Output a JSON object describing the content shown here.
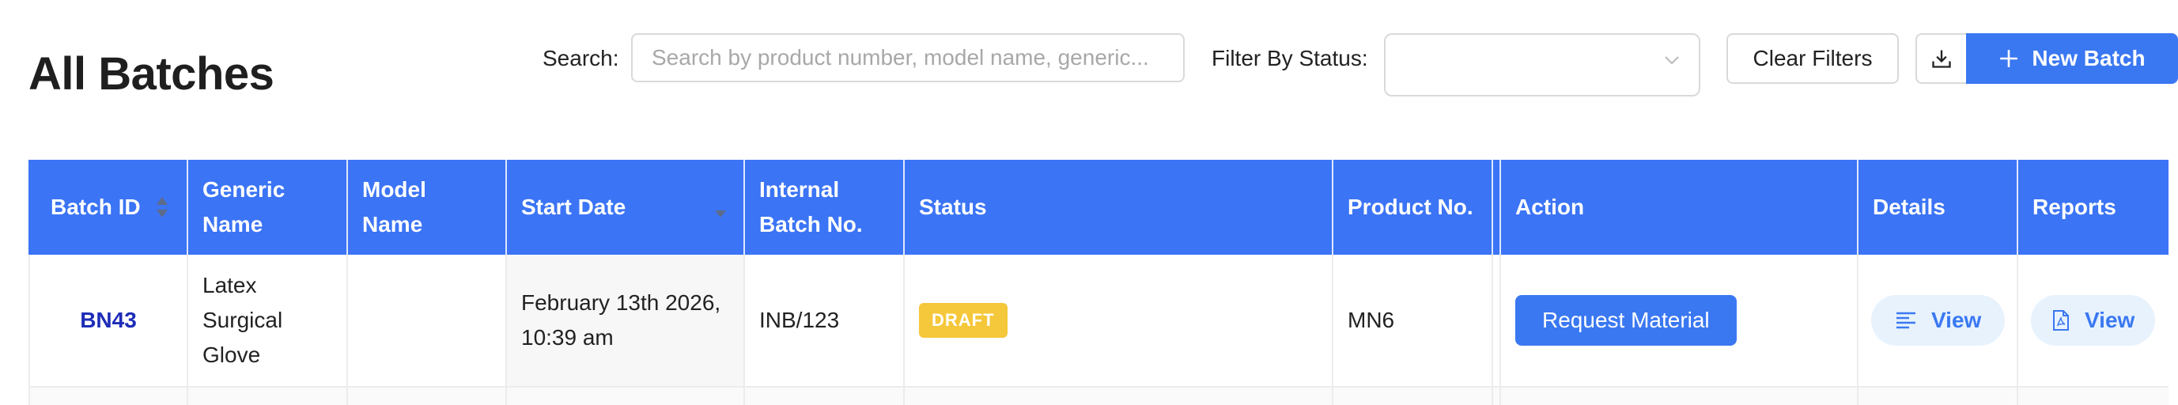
{
  "page": {
    "title": "All Batches"
  },
  "toolbar": {
    "search_label": "Search:",
    "search_placeholder": "Search by product number, model name, generic...",
    "search_value": "",
    "filter_label": "Filter By Status:",
    "filter_value": "",
    "clear_label": "Clear Filters",
    "new_batch_label": "New Batch"
  },
  "table": {
    "headers": {
      "batch_id": "Batch ID",
      "generic_name": [
        "Generic",
        "Name"
      ],
      "model_name": [
        "Model",
        "Name"
      ],
      "start_date": "Start Date",
      "internal_batch": [
        "Internal",
        "Batch No."
      ],
      "status": "Status",
      "product_no": "Product No.",
      "action": "Action",
      "details": "Details",
      "reports": "Reports"
    },
    "rows": [
      {
        "batch_id": "BN43",
        "generic_name": [
          "Latex",
          "Surgical",
          "Glove"
        ],
        "model_name": "",
        "start_date": [
          "February 13th 2026,",
          "10:39 am"
        ],
        "internal_batch": "INB/123",
        "status": "DRAFT",
        "product_no": "MN6",
        "action": "Request Material",
        "details": "View",
        "reports": "View"
      }
    ]
  },
  "colors": {
    "accent": "#3a78f2",
    "header_bg": "#3b74f5",
    "badge_draft": "#f5c73a",
    "link": "#1d2db8",
    "view_bg": "#e7f2fd"
  }
}
